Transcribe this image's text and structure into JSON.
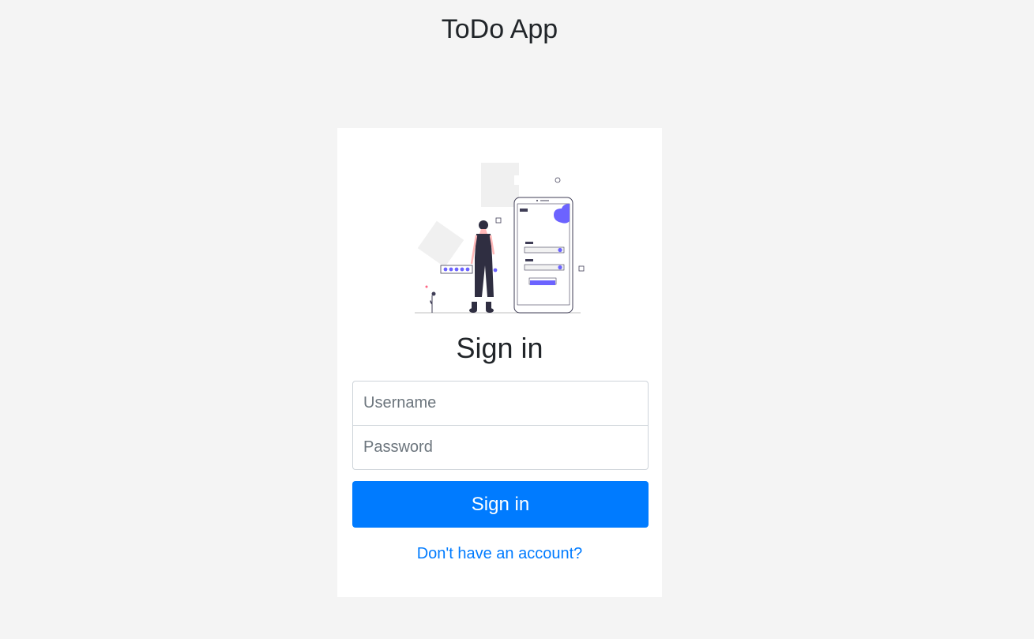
{
  "header": {
    "title": "ToDo App"
  },
  "form": {
    "heading": "Sign in",
    "username_placeholder": "Username",
    "password_placeholder": "Password",
    "submit_label": "Sign in",
    "register_link": "Don't have an account?"
  },
  "colors": {
    "primary": "#007bff",
    "background": "#f4f4f4",
    "card": "#ffffff",
    "illustration_accent": "#6c63ff"
  },
  "icons": {
    "illustration": "login-illustration"
  }
}
